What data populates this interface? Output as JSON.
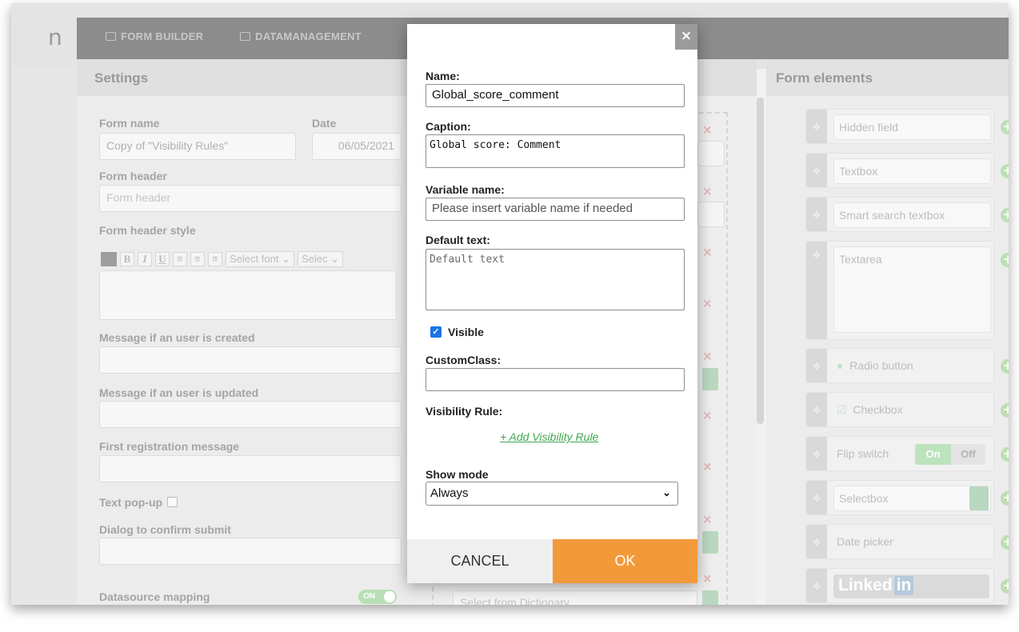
{
  "app": {
    "logo_text": "n",
    "nav": [
      {
        "label": "FORM BUILDER"
      },
      {
        "label": "DATAMANAGEMENT"
      }
    ]
  },
  "settings": {
    "title": "Settings",
    "form_name_label": "Form name",
    "form_name_value": "Copy of \"Visibility Rules\"",
    "date_label": "Date",
    "date_value": "06/05/2021",
    "form_header_label": "Form header",
    "form_header_placeholder": "Form header",
    "form_header_style_label": "Form header style",
    "toolbar": {
      "bold": "B",
      "italic": "I",
      "underline": "U",
      "font_select": "Select font",
      "size_select": "Selec"
    },
    "msg_created_label": "Message if an user is created",
    "msg_updated_label": "Message if an user is updated",
    "first_reg_label": "First registration message",
    "text_popup_label": "Text pop-up",
    "confirm_label": "Dialog to confirm submit",
    "datasource_label": "Datasource mapping",
    "datasource_toggle": "ON"
  },
  "middle": {
    "select_dictionary": "Select from Dictionary"
  },
  "form_elements": {
    "title": "Form elements",
    "items": [
      {
        "label": "Hidden field"
      },
      {
        "label": "Textbox"
      },
      {
        "label": "Smart search textbox"
      },
      {
        "label": "Textarea"
      },
      {
        "label": "Radio button"
      },
      {
        "label": "Checkbox"
      },
      {
        "label": "Flip switch"
      },
      {
        "label": "Selectbox"
      },
      {
        "label": "Date picker"
      }
    ],
    "flip_on": "On",
    "flip_off": "Off",
    "linkedin_text": "Linked",
    "linkedin_in": "in"
  },
  "modal": {
    "close_glyph": "×",
    "name_label": "Name:",
    "name_value": "Global_score_comment",
    "caption_label": "Caption:",
    "caption_value": "Global score: Comment",
    "variable_label": "Variable name:",
    "variable_placeholder": "Please insert variable name if needed",
    "default_label": "Default text:",
    "default_placeholder": "Default text",
    "visible_label": "Visible",
    "visible_checked": true,
    "customclass_label": "CustomClass:",
    "customclass_value": "",
    "visibility_rule_label": "Visibility Rule:",
    "add_rule_link": "+ Add Visibility Rule",
    "show_mode_label": "Show mode",
    "show_mode_value": "Always",
    "cancel_label": "CANCEL",
    "ok_label": "OK"
  },
  "colors": {
    "accent_ok": "#f29a3a",
    "link_green": "#3fa84f",
    "checkbox_blue": "#1a73e8"
  }
}
